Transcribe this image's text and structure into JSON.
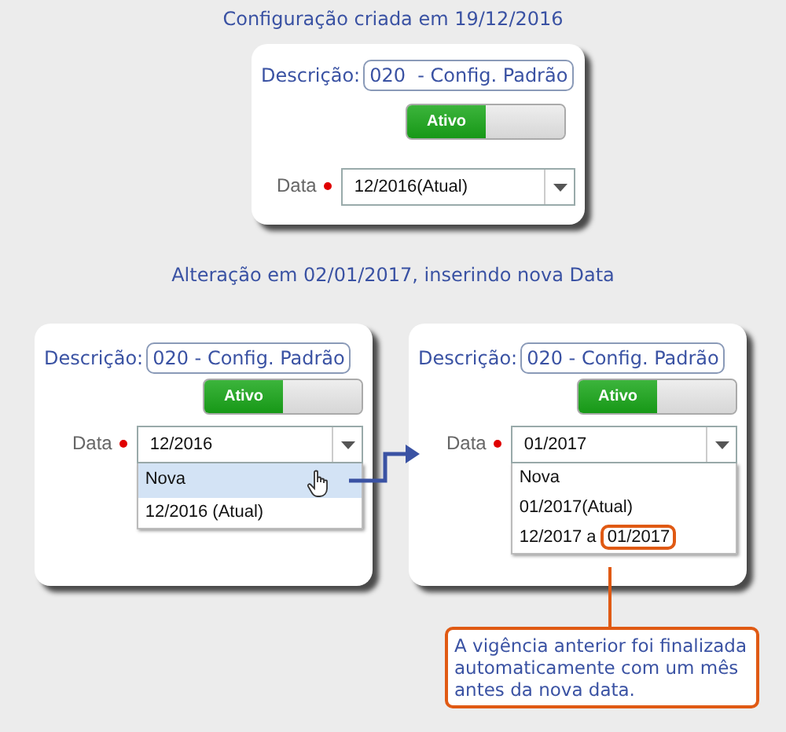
{
  "title_1": "Configuração criada em 19/12/2016",
  "panel_1": {
    "description_label": "Descrição:",
    "description_value": "020  - Config. Padrão",
    "toggle": {
      "label": "Ativo",
      "on": true
    },
    "date_label": "Data",
    "date_value": "12/2016(Atual)"
  },
  "title_2": "Alteração em 02/01/2017, inserindo nova Data",
  "panels": [
    {
      "description_label": "Descrição:",
      "description_value": "020 - Config. Padrão",
      "toggle": {
        "label": "Ativo",
        "on": true
      },
      "date_label": "Data",
      "date_value": "12/2016",
      "options": [
        {
          "text": "Nova",
          "selected": true
        },
        {
          "text": "12/2016 (Atual)",
          "selected": false
        }
      ]
    },
    {
      "description_label": "Descrição:",
      "description_value": "020 - Config. Padrão",
      "toggle": {
        "label": "Ativo",
        "on": true
      },
      "date_label": "Data",
      "date_value": "01/2017",
      "options": [
        {
          "text": "Nova",
          "selected": false
        },
        {
          "text": "01/2017(Atual)",
          "selected": false
        },
        {
          "text": "12/2017 a",
          "highlight": "01/2017",
          "selected": false
        }
      ]
    }
  ],
  "callout": "A vigência anterior foi finalizada automaticamente com um mês antes da nova data."
}
